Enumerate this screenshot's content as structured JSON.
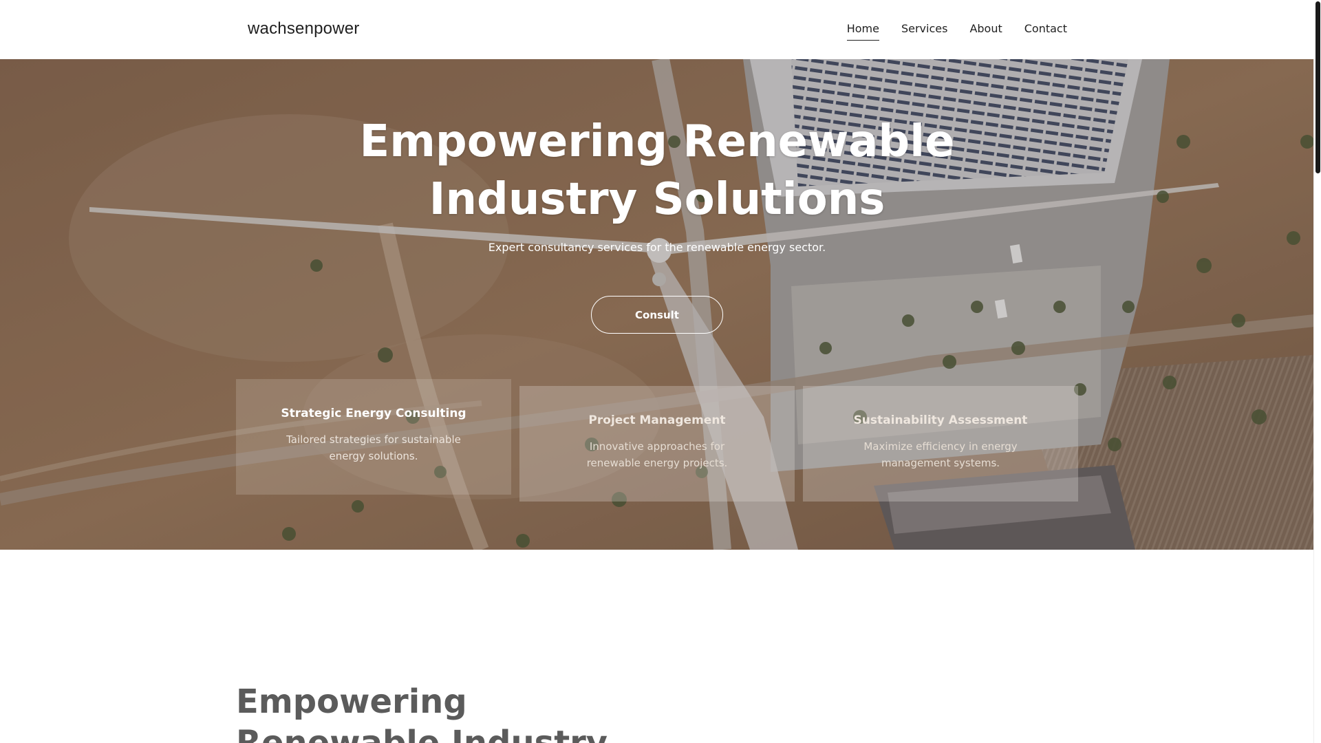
{
  "header": {
    "logo": "wachsenpower",
    "nav": [
      {
        "label": "Home",
        "active": true
      },
      {
        "label": "Services",
        "active": false
      },
      {
        "label": "About",
        "active": false
      },
      {
        "label": "Contact",
        "active": false
      }
    ]
  },
  "hero": {
    "title_line1": "Empowering Renewable",
    "title_line2": "Industry Solutions",
    "subtitle": "Expert consultancy services for the renewable energy sector.",
    "cta_label": "Consult",
    "background_description_icon": "aerial-photo-wind-turbine-solar-factory"
  },
  "services": [
    {
      "title": "Strategic Energy Consulting",
      "description": "Tailored strategies for sustainable energy solutions."
    },
    {
      "title": "Project Management",
      "description": "Innovative approaches for renewable energy projects."
    },
    {
      "title": "Sustainability Assessment",
      "description": "Maximize efficiency in energy management systems."
    }
  ],
  "section": {
    "heading_line1": "Empowering",
    "heading_line2": "Renewable Industry"
  },
  "colors": {
    "text_dark": "#1f1f1f",
    "hero_text": "#ffffff",
    "section_heading": "#5b5b5b"
  }
}
